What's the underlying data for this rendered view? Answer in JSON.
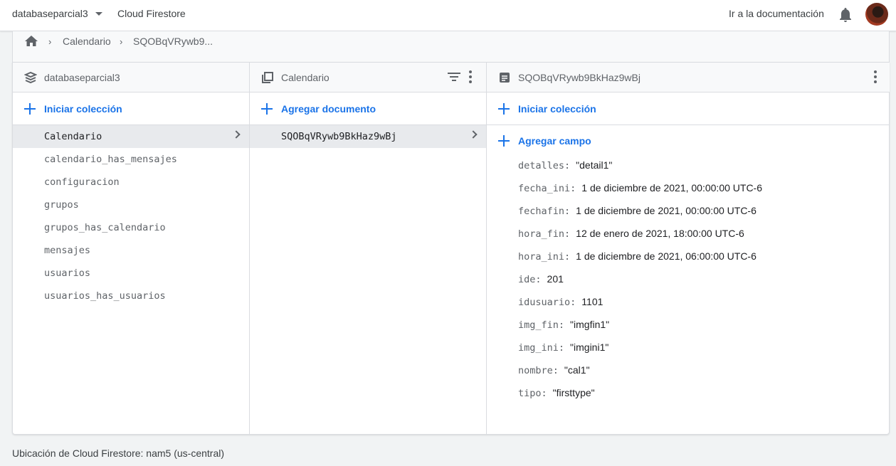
{
  "topbar": {
    "project": "databaseparcial3",
    "product": "Cloud Firestore",
    "docs_link": "Ir a la documentación"
  },
  "breadcrumb": {
    "items": [
      "Calendario",
      "SQOBqVRywb9..."
    ]
  },
  "columns": {
    "root": {
      "title": "databaseparcial3",
      "action": "Iniciar colección",
      "items": [
        "Calendario",
        "calendario_has_mensajes",
        "configuracion",
        "grupos",
        "grupos_has_calendario",
        "mensajes",
        "usuarios",
        "usuarios_has_usuarios"
      ],
      "selected_index": 0
    },
    "collection": {
      "title": "Calendario",
      "action": "Agregar documento",
      "items": [
        "SQOBqVRywb9BkHaz9wBj"
      ],
      "selected_index": 0
    },
    "document": {
      "title": "SQOBqVRywb9BkHaz9wBj",
      "action_collection": "Iniciar colección",
      "action_field": "Agregar campo",
      "fields": [
        {
          "key": "detalles",
          "value": "\"detail1\""
        },
        {
          "key": "fecha_ini",
          "value": "1 de diciembre de 2021, 00:00:00 UTC-6"
        },
        {
          "key": "fechafin",
          "value": "1 de diciembre de 2021, 00:00:00 UTC-6"
        },
        {
          "key": "hora_fin",
          "value": "12 de enero de 2021, 18:00:00 UTC-6"
        },
        {
          "key": "hora_ini",
          "value": "1 de diciembre de 2021, 06:00:00 UTC-6"
        },
        {
          "key": "ide",
          "value": "201"
        },
        {
          "key": "idusuario",
          "value": "1101"
        },
        {
          "key": "img_fin",
          "value": "\"imgfin1\""
        },
        {
          "key": "img_ini",
          "value": "\"imgini1\""
        },
        {
          "key": "nombre",
          "value": "\"cal1\""
        },
        {
          "key": "tipo",
          "value": "\"firsttype\""
        }
      ]
    }
  },
  "footer": {
    "location": "Ubicación de Cloud Firestore: nam5 (us-central)"
  },
  "colors": {
    "accent": "#1a73e8",
    "selected_row": "#e8eaed",
    "border": "#dadce0"
  },
  "icons": {
    "project_menu": "chevron-down-icon",
    "notifications": "bell-icon",
    "home": "home-icon",
    "database": "database-icon",
    "collection": "collection-icon",
    "document": "document-icon",
    "filter": "filter-icon",
    "more": "more-vert-icon",
    "add": "plus-icon",
    "expand": "chevron-right-icon"
  }
}
